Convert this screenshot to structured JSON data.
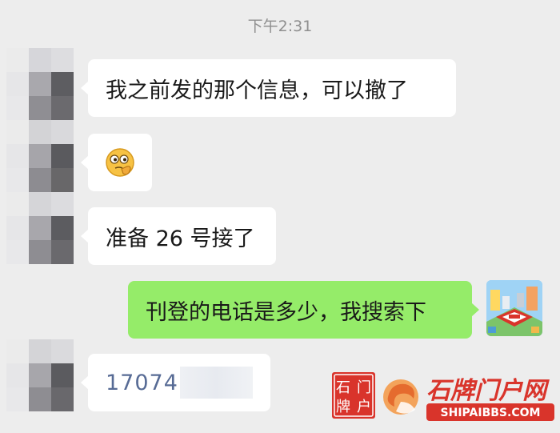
{
  "chat": {
    "timestamp": "下午2:31",
    "messages": [
      {
        "text": "我之前发的那个信息，可以撤了"
      },
      {
        "emoji": "thinking-face-emoji"
      },
      {
        "text": "准备 26 号接了"
      },
      {
        "text": "刊登的电话是多少，我搜索下"
      },
      {
        "phone_visible": "17074"
      }
    ]
  },
  "watermark": {
    "seal_chars": [
      "石",
      "门",
      "牌",
      "户"
    ],
    "brand": "石牌门户网",
    "url": "SHIPAIBBS.COM"
  },
  "colors": {
    "background": "#ededed",
    "incoming_bubble": "#ffffff",
    "outgoing_bubble": "#95ec69",
    "phone_link": "#576b95",
    "brand_red": "#d9342b"
  }
}
